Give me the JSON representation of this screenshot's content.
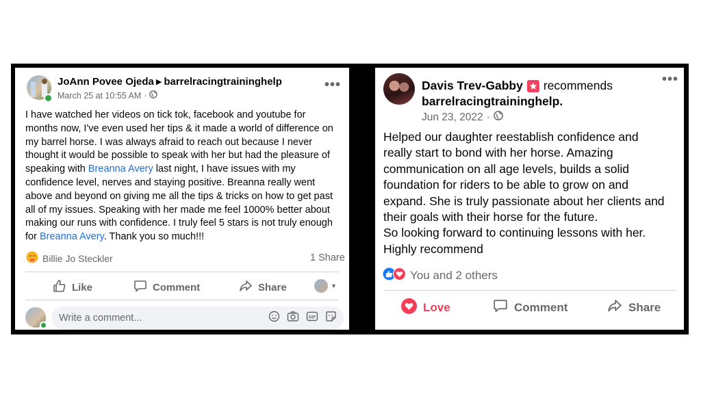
{
  "left_post": {
    "author": "JoAnn Povee Ojeda",
    "page": "barrelracingtraininghelp",
    "timestamp": "March 25 at 10:55 AM",
    "separator": "·",
    "text_parts": [
      "I have watched her videos on tick tok, facebook and youtube for months now, I've even used her tips & it made a world of difference on my barrel horse. I  was always afraid to reach out because I never thought it would be possible to speak with her but had the pleasure of speaking with ",
      " last night, I have issues with my confidence level, nerves and staying positive. Breanna really went above and beyond on giving me all the tips & tricks on how to get past all of my issues. Speaking with her made me feel 1000% better about making our runs with confidence. I truly feel 5 stars is not truly enough for ",
      ". Thank you so much!!!"
    ],
    "mention_1": "Breanna Avery",
    "mention_2": "Breanna Avery",
    "reactor": "Billie Jo Steckler",
    "share_count": "1 Share",
    "actions": {
      "like": "Like",
      "comment": "Comment",
      "share": "Share"
    },
    "comment_placeholder": "Write a comment..."
  },
  "right_post": {
    "author": "Davis Trev-Gabby",
    "recommends_label": "recommends",
    "page": "barrelracingtraininghelp.",
    "date": "Jun 23, 2022",
    "separator": "·",
    "lines": [
      "Helped our daughter reestablish confidence and",
      "really start to bond with her horse. Amazing",
      "communication on all age levels, builds a solid",
      "foundation for riders to be able to grow on and",
      "expand. She is truly passionate about her clients and",
      "their goals with their horse for the future.",
      "So looking forward to continuing lessons with her.",
      "Highly recommend"
    ],
    "reactions_text": "You and 2 others",
    "actions": {
      "love": "Love",
      "comment": "Comment",
      "share": "Share"
    }
  },
  "colors": {
    "link": "#216fdb",
    "love": "#f33e58",
    "like_blue": "#1877f2",
    "online": "#31a24c",
    "muted": "#65676b"
  }
}
